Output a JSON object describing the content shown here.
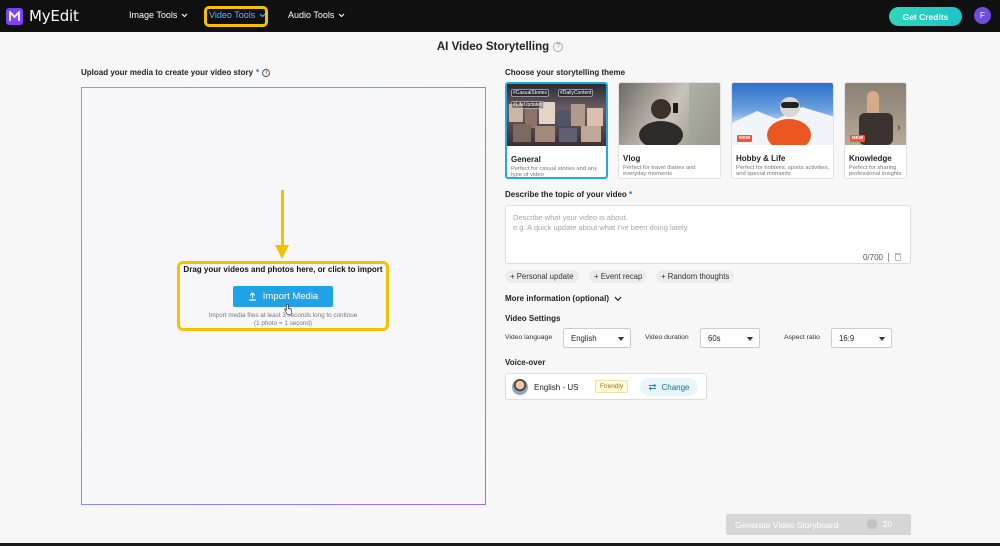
{
  "topbar": {
    "brand": "MyEdit",
    "nav": [
      {
        "label": "Image Tools"
      },
      {
        "label": "Video Tools"
      },
      {
        "label": "Audio Tools"
      }
    ],
    "credits_label": "Get Credits",
    "avatar_letter": "F"
  },
  "page": {
    "title": "AI Video Storytelling"
  },
  "upload": {
    "label": "Upload your media to create your video story",
    "required_mark": "*",
    "drag_text": "Drag your videos and photos here, or click to import",
    "import_button": "Import Media",
    "hint_line1": "Import media files at least 3 seconds long to continue",
    "hint_line2": "(1 photo = 1 second)"
  },
  "themes": {
    "label": "Choose your storytelling theme",
    "items": [
      {
        "name": "General",
        "desc": "Perfect for casual stories and any type of video",
        "tags": [
          "#CasualStories",
          "#DailyContent",
          "#LifeUpdates"
        ],
        "new": false,
        "selected": true
      },
      {
        "name": "Vlog",
        "desc": "Perfect for travel diaries and everyday moments",
        "new": false,
        "selected": false
      },
      {
        "name": "Hobby & Life",
        "desc": "Perfect for hobbies, sports activities, and special moments",
        "new": true,
        "selected": false
      },
      {
        "name": "Knowledge",
        "desc": "Perfect for sharing professional insights",
        "new": true,
        "selected": false
      }
    ],
    "new_badge": "NEW"
  },
  "topic": {
    "label": "Describe the topic of your video",
    "required_mark": "*",
    "placeholder_line1": "Describe what your video is about.",
    "placeholder_line2": "e.g. A quick update about what I've been doing lately.",
    "char_count": "0/700"
  },
  "chips": [
    "+ Personal update",
    "+ Event recap",
    "+ Random thoughts"
  ],
  "more_info": "More information (optional)",
  "settings": {
    "label": "Video Settings",
    "language_label": "Video language",
    "language_value": "English",
    "duration_label": "Video duration",
    "duration_value": "60s",
    "aspect_label": "Aspect ratio",
    "aspect_value": "16:9"
  },
  "voice": {
    "label": "Voice-over",
    "name": "English - US",
    "style": "Friendly",
    "change_label": "Change"
  },
  "generate": {
    "label": "Generate Video Storyboard",
    "cost": "20"
  },
  "colors": {
    "accent": "#1fa3e6",
    "highlight": "#f2c200",
    "credits": "#1ec4c9"
  }
}
